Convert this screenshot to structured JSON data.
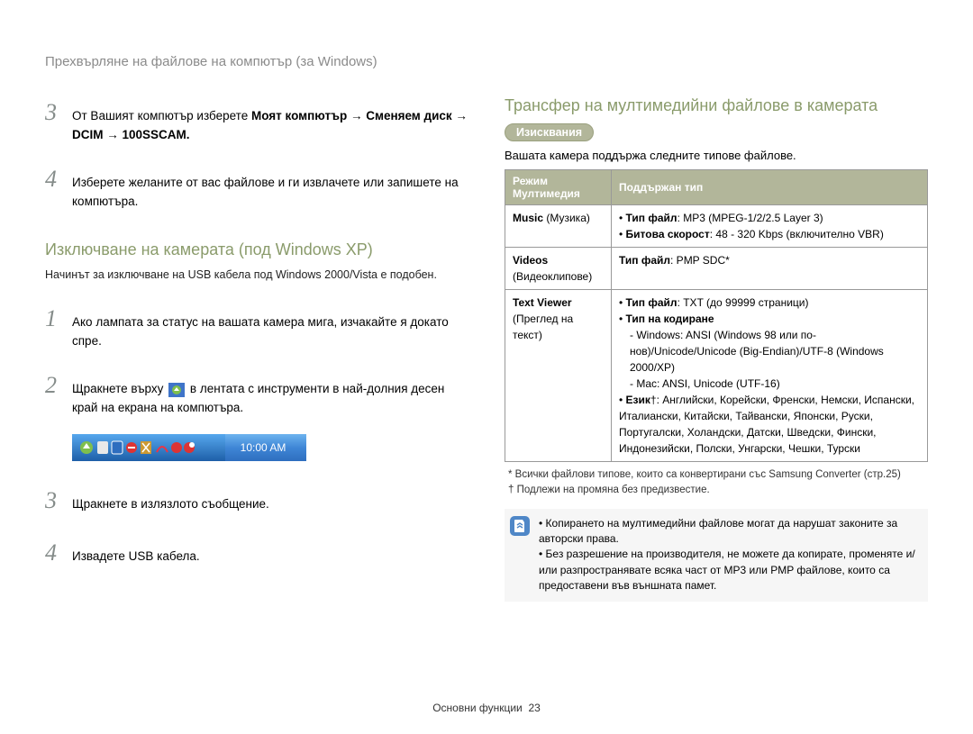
{
  "page_title": "Прехвърляне на файлове на компютър (за Windows)",
  "left": {
    "step3": {
      "prefix": "От Вашият компютър изберете ",
      "bold": "Моят компютър → Сменяем диск → DCIM → 100SSCAM"
    },
    "step4": "Изберете желаните от вас файлове и ги извлачете или запишете на компютъра.",
    "heading2": "Изключване на камерата (под Windows XP)",
    "sub_note": "Начинът за изключване на USB кабела под Windows 2000/Vista е подобен.",
    "s1": "Ако лампата за статус на вашата камера мига, изчакайте я докато спре.",
    "s2_a": "Щракнете върху ",
    "s2_b": " в лентата с инструменти в най-долния десен край на екрана на компютъра.",
    "taskbar_time": "10:00 AM",
    "s3": "Щракнете в излязлото съобщение.",
    "s4": "Извадете USB кабела."
  },
  "right": {
    "heading": "Трансфер на мултимедийни файлове в камерата",
    "pill": "Изисквания",
    "intro": "Вашата камера поддържа следните типове файлове.",
    "th1_a": "Режим",
    "th1_b": "Мултимедия",
    "th2": "Поддържан тип",
    "row1": {
      "mode_b": "Music",
      "mode_p": " (Музика)",
      "b1a": "Тип файл",
      "b1b": ": MP3 (MPEG-1/2/2.5 Layer 3)",
      "b2a": "Битова скорост",
      "b2b": ": 48 - 320 Kbps (включително VBR)"
    },
    "row2": {
      "mode_b": "Videos",
      "mode_p": "(Видеоклипове)",
      "b1a": "Тип файл",
      "b1b": ": PMP SDC*"
    },
    "row3": {
      "mode_b": "Text Viewer",
      "mode_p": "(Преглед на текст)",
      "b1a": "Тип файл",
      "b1b": ": TXT (до 99999 страници)",
      "b2": "Тип на кодиране",
      "sub1": "Windows: ANSI (Windows 98 или по-нов)/Unicode/Unicode (Big-Endian)/UTF-8 (Windows 2000/XP)",
      "sub2": "Mac: ANSI, Unicode (UTF-16)",
      "b3a": "Език",
      "b3b": "†: Английски, Корейски, Френски, Немски, Испански, Италиански, Китайски, Тайвански, Японски, Руски, Португалски, Холандски, Датски, Шведски, Фински, Индонезийски, Полски, Унгарски, Чешки, Турски"
    },
    "fn1": "* Всички файлови типове, които са конвертирани със Samsung Converter (стр.25)",
    "fn2": "† Подлежи на промяна без предизвестие.",
    "info1": "Копирането на мултимедийни файлове могат да нарушат законите за авторски права.",
    "info2": "Без разрешение на производителя, не можете да копирате, променяте и/или разпространявате всяка част от MP3 или PMP файлове, които са предоставени във външната памет."
  },
  "footer_label": "Основни функции",
  "footer_page": "23"
}
